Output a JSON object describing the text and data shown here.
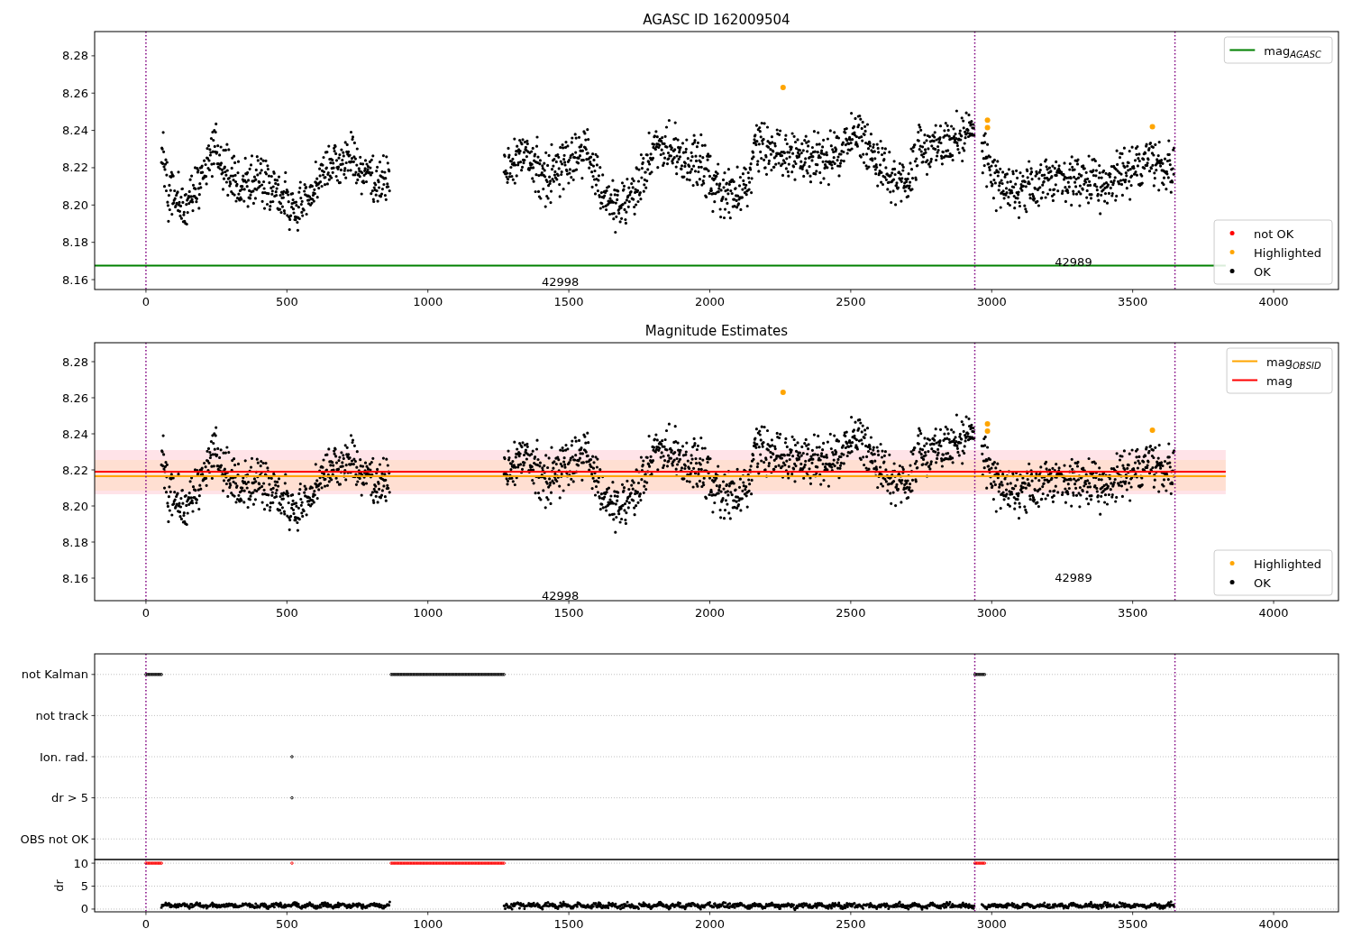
{
  "figure": {
    "panels": [
      {
        "kind": "mag",
        "title": "AGASC ID 162009504",
        "line_legend": [
          {
            "label": "mag$_{AGASC}$",
            "color": "#008000"
          }
        ],
        "marker_legend": [
          {
            "kind": "entry",
            "label": "not OK",
            "color": "#ff0000"
          },
          {
            "kind": "series"
          },
          {
            "kind": "entry",
            "label": "OK",
            "color": "#000000"
          }
        ],
        "chart_data": {
          "type": "scatter",
          "xlim": [
            -182,
            4230
          ],
          "ylim": [
            8.1547,
            8.293
          ],
          "xticks": [
            0,
            500,
            1000,
            1500,
            2000,
            2500,
            3000,
            3500,
            4000
          ],
          "yticks": [
            {
              "value": 8.16,
              "label": "8.16"
            },
            {
              "value": 8.18,
              "label": "8.18"
            },
            {
              "value": 8.2,
              "label": "8.20"
            },
            {
              "value": 8.22,
              "label": "8.22"
            },
            {
              "value": 8.24,
              "label": "8.24"
            },
            {
              "value": 8.26,
              "label": "8.26"
            },
            {
              "value": 8.28,
              "label": "8.28"
            }
          ],
          "series": [
            {
              "name": "Highlighted",
              "color": "#ffa500",
              "x": [
                2260,
                2985,
                2985,
                3570
              ],
              "values": [
                8.263,
                8.2455,
                8.2415,
                8.242
              ]
            }
          ],
          "ref_lines": [
            {
              "axis": "y",
              "value": 8.1675,
              "color": "#008000"
            },
            {
              "axis": "x",
              "value": 0,
              "color": "#800080"
            },
            {
              "axis": "x",
              "value": 2940,
              "color": "#800080"
            },
            {
              "axis": "x",
              "value": 3650,
              "color": "#800080"
            }
          ],
          "annotations": [
            {
              "text": "42998"
            },
            {
              "text": "42989"
            }
          ]
        }
      },
      {
        "kind": "mag",
        "title": "Magnitude Estimates",
        "line_legend": [
          {
            "label": "mag$_{OBSID}$",
            "color": "#ffa500"
          },
          {
            "label": "mag",
            "color": "#ff0000"
          }
        ],
        "marker_legend": [
          {
            "kind": "series"
          },
          {
            "kind": "entry",
            "label": "OK",
            "color": "#000000"
          }
        ],
        "chart_data": {
          "type": "scatter",
          "xlim": [
            -182,
            4230
          ],
          "ylim": [
            8.1475,
            8.2905
          ],
          "xticks": [
            0,
            500,
            1000,
            1500,
            2000,
            2500,
            3000,
            3500,
            4000
          ],
          "yticks": [
            {
              "value": 8.16,
              "label": "8.16"
            },
            {
              "value": 8.18,
              "label": "8.18"
            },
            {
              "value": 8.2,
              "label": "8.20"
            },
            {
              "value": 8.22,
              "label": "8.22"
            },
            {
              "value": 8.24,
              "label": "8.24"
            },
            {
              "value": 8.26,
              "label": "8.26"
            },
            {
              "value": 8.28,
              "label": "8.28"
            }
          ],
          "series": [
            {
              "name": "Highlighted",
              "color": "#ffa500",
              "x": [
                2260,
                2985,
                2985,
                3570
              ],
              "values": [
                8.263,
                8.2455,
                8.2415,
                8.242
              ]
            }
          ],
          "bands": [
            {
              "axis": "y",
              "from": 8.2065,
              "to": 8.231,
              "color": "#ffc0cb"
            },
            {
              "axis": "y",
              "from": 8.2085,
              "to": 8.2255,
              "color": "#ffdab9"
            }
          ],
          "ref_lines": [
            {
              "axis": "y",
              "value": 8.2165,
              "color": "#ffa500"
            },
            {
              "axis": "y",
              "value": 8.219,
              "color": "#ff0000"
            },
            {
              "axis": "x",
              "value": 0,
              "color": "#800080"
            },
            {
              "axis": "x",
              "value": 2940,
              "color": "#800080"
            },
            {
              "axis": "x",
              "value": 3650,
              "color": "#800080"
            }
          ],
          "annotations": [
            {
              "text": "42998"
            },
            {
              "text": "42989"
            }
          ]
        }
      },
      {
        "kind": "flags",
        "row_labels": [
          "not Kalman",
          "not track",
          "Ion. rad.",
          "dr > 5",
          "OBS not OK"
        ]
      },
      {
        "kind": "dr",
        "chart_data": {
          "type": "scatter",
          "ylabel": "dr",
          "grid": true,
          "xlim": [
            -182,
            4230
          ],
          "ylim": [
            -0.6,
            10.8
          ],
          "xticks": [
            0,
            500,
            1000,
            1500,
            2000,
            2500,
            3000,
            3500,
            4000
          ],
          "yticks": [
            0,
            5,
            10
          ],
          "ref_lines": [
            {
              "axis": "x",
              "value": 0,
              "color": "#800080"
            },
            {
              "axis": "x",
              "value": 2940,
              "color": "#800080"
            },
            {
              "axis": "x",
              "value": 3650,
              "color": "#800080"
            }
          ]
        }
      }
    ]
  }
}
